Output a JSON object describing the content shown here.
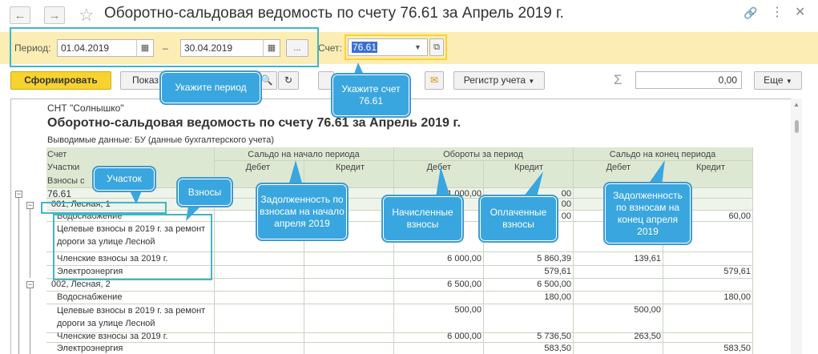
{
  "window": {
    "title": "Оборотно-сальдовая ведомость по счету 76.61 за Апрель 2019 г.",
    "back_icon": "arrow-left-icon",
    "forward_icon": "arrow-right-icon",
    "favorite_icon": "star-icon",
    "link_icon": "link-icon",
    "menu_icon": "more-icon",
    "close_icon": "close-icon"
  },
  "period": {
    "label": "Период:",
    "from": "01.04.2019",
    "dash": "–",
    "to": "30.04.2019",
    "more_button": "...",
    "account_label": "Счет:",
    "account_value": "76.61"
  },
  "toolbar": {
    "generate": "Сформировать",
    "show": "Показ",
    "register": "Регистр учета",
    "sum_symbol": "Σ",
    "sum_value": "0,00",
    "more": "Еще"
  },
  "report": {
    "org": "СНТ \"Солнышко\"",
    "title": "Оборотно-сальдовая ведомость по счету 76.61 за Апрель 2019 г.",
    "subtitle": "Выводимые данные:  БУ (данные бухгалтерского учета)",
    "headers": {
      "account": "Счет",
      "plots": "Участки",
      "dues": "Взносы с",
      "opening": "Сальдо на начало периода",
      "turnover": "Обороты за период",
      "closing": "Сальдо на конец периода",
      "debit": "Дебет",
      "credit": "Кредит"
    },
    "rows": [
      {
        "name": "76.61",
        "c3": "91 000,00",
        "c4": "00"
      },
      {
        "name": "001, Лесная, 1",
        "c4": "00"
      },
      {
        "name": "Водоснабжение",
        "c4": "00",
        "c6": "60,00"
      },
      {
        "name": "Целевые взносы в 2019 г. за ремонт дороги за улице Лесной"
      },
      {
        "name": "Членские взносы за 2019 г.",
        "c3": "6 000,00",
        "c4": "5 860,39",
        "c5": "139,61"
      },
      {
        "name": "Электроэнергия",
        "c4": "579,61",
        "c6": "579,61"
      },
      {
        "name": "002, Лесная, 2",
        "c3": "6 500,00",
        "c4": "6 500,00"
      },
      {
        "name": "Водоснабжение",
        "c4": "180,00",
        "c6": "180,00"
      },
      {
        "name": "Целевые взносы в 2019 г. за ремонт дороги за улице Лесной",
        "c3": "500,00",
        "c5": "500,00"
      },
      {
        "name": "Членские взносы за 2019 г.",
        "c3": "6 000,00",
        "c4": "5 736,50",
        "c5": "263,50"
      },
      {
        "name": "Электроэнергия",
        "c4": "583,50",
        "c6": "583,50"
      }
    ]
  },
  "callouts": {
    "period": "Укажите период",
    "account": "Укажите счет 76.61",
    "plot": "Участок",
    "dues": "Взносы",
    "opening_debt": "Задолженность по взносам на начало апреля 2019",
    "accrued": "Начисленные взносы",
    "paid": "Оплаченные взносы",
    "closing_debt": "Задолженность по взносам на конец апреля 2019"
  },
  "colors": {
    "accent": "#3aa6df",
    "highlight": "#3fb6c4",
    "period_bar": "#fcedb4",
    "primary_button": "#f7d330"
  }
}
